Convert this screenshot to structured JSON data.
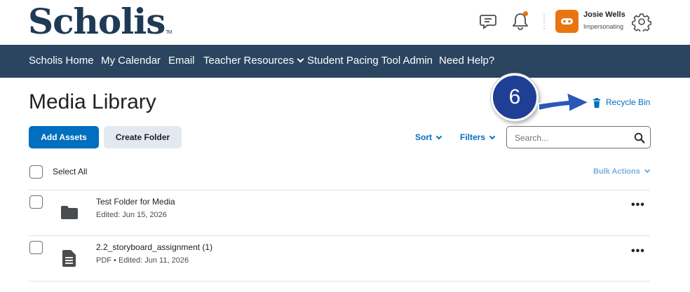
{
  "header": {
    "logo_text": "Scholis",
    "logo_mark": "TM",
    "user_name": "Josie Wells",
    "user_role": "Impersonating",
    "icons": [
      "message-alerts-icon",
      "notification-bell-icon",
      "user-avatar",
      "settings-gear-icon"
    ],
    "notification_dot_color": "#e87511"
  },
  "nav": {
    "bg_color": "#2b4560",
    "items": [
      {
        "label": "Scholis Home"
      },
      {
        "label": "My Calendar"
      },
      {
        "label": "Email"
      },
      {
        "label": "Teacher Resources",
        "has_dropdown": true
      },
      {
        "label": "Student Pacing Tool Admin"
      },
      {
        "label": "Need Help?"
      }
    ]
  },
  "page": {
    "title": "Media Library",
    "recycle_bin_label": "Recycle Bin",
    "callout_number": "6",
    "callout_color": "#1e3f94"
  },
  "toolbar": {
    "add_assets_label": "Add Assets",
    "create_folder_label": "Create Folder",
    "sort_label": "Sort",
    "filters_label": "Filters",
    "search_placeholder": "Search...",
    "accent_color": "#006fbf"
  },
  "list": {
    "select_all_label": "Select All",
    "bulk_actions_label": "Bulk Actions",
    "items": [
      {
        "title": "Test Folder for Media",
        "meta": "Edited: Jun 15, 2026",
        "icon": "folder-icon"
      },
      {
        "title": "2.2_storyboard_assignment (1)",
        "meta": "PDF  •  Edited: Jun 11, 2026",
        "icon": "document-icon"
      }
    ],
    "more_label": "•••"
  }
}
